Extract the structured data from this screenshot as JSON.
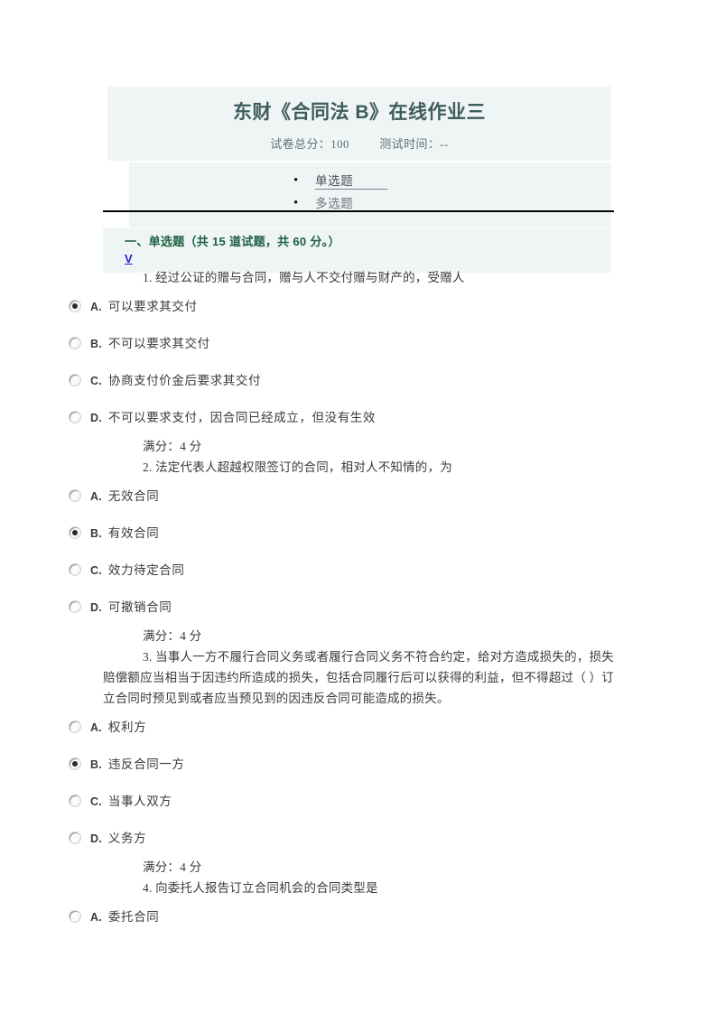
{
  "header": {
    "title": "东财《合同法 B》在线作业三",
    "total_score_label": "试卷总分：100",
    "test_time_label": "测试时间：--",
    "nav": [
      {
        "label": "单选题",
        "style": "primary"
      },
      {
        "label": "多选题",
        "style": "secondary"
      }
    ]
  },
  "section": {
    "heading": "一、单选题（共 15 道试题，共 60 分。）",
    "anchor": "V"
  },
  "score_line": "满分：4 分",
  "questions": [
    {
      "number": "1.",
      "text": "1. 经过公证的赠与合同，赠与人不交付赠与财产的，受赠人",
      "options": [
        {
          "letter": "A.",
          "label": "可以要求其交付",
          "selected": true
        },
        {
          "letter": "B.",
          "label": "不可以要求其交付",
          "selected": false
        },
        {
          "letter": "C.",
          "label": "协商支付价金后要求其交付",
          "selected": false
        },
        {
          "letter": "D.",
          "label": "不可以要求支付，因合同已经成立，但没有生效",
          "selected": false
        }
      ],
      "score": "满分：4 分"
    },
    {
      "number": "2.",
      "text": "2. 法定代表人超越权限签订的合同，相对人不知情的，为",
      "options": [
        {
          "letter": "A.",
          "label": "无效合同",
          "selected": false
        },
        {
          "letter": "B.",
          "label": "有效合同",
          "selected": true
        },
        {
          "letter": "C.",
          "label": "效力待定合同",
          "selected": false
        },
        {
          "letter": "D.",
          "label": "可撤销合同",
          "selected": false
        }
      ],
      "score": "满分：4 分"
    },
    {
      "number": "3.",
      "text": "3. 当事人一方不履行合同义务或者履行合同义务不符合约定，给对方造成损失的，损失赔偿额应当相当于因违约所造成的损失，包括合同履行后可以获得的利益，但不得超过（ ）订立合同时预见到或者应当预见到的因违反合同可能造成的损失。",
      "options": [
        {
          "letter": "A.",
          "label": "权利方",
          "selected": false
        },
        {
          "letter": "B.",
          "label": "违反合同一方",
          "selected": true
        },
        {
          "letter": "C.",
          "label": "当事人双方",
          "selected": false
        },
        {
          "letter": "D.",
          "label": "义务方",
          "selected": false
        }
      ],
      "score": "满分：4 分"
    },
    {
      "number": "4.",
      "text": "4. 向委托人报告订立合同机会的合同类型是",
      "options": [
        {
          "letter": "A.",
          "label": "委托合同",
          "selected": false
        }
      ],
      "score": ""
    }
  ],
  "colors": {
    "band": "#eff4f4",
    "title": "#3d5c5e",
    "section_heading": "#1d6040",
    "anchor": "#2020c8"
  }
}
